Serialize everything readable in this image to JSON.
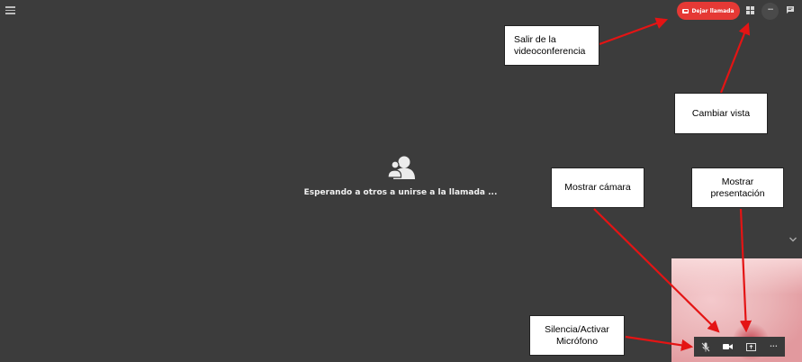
{
  "header": {
    "leave_button_label": "Dejar llamada",
    "more_icon_text": "•••"
  },
  "main": {
    "waiting_text": "Esperando a otros a unirse a la llamada ..."
  },
  "toolbar": {
    "more_text": "•••"
  },
  "annotations": {
    "salir": "Salir de la videoconferencia",
    "cambiar_vista": "Cambiar vista",
    "mostrar_camara": "Mostrar cámara",
    "mostrar_presentacion": "Mostrar presentación",
    "silenciar": "Silencia/Activar Micrófono"
  },
  "colors": {
    "background": "#3c3c3c",
    "leave_button": "#e53935",
    "arrow": "#e41414"
  }
}
